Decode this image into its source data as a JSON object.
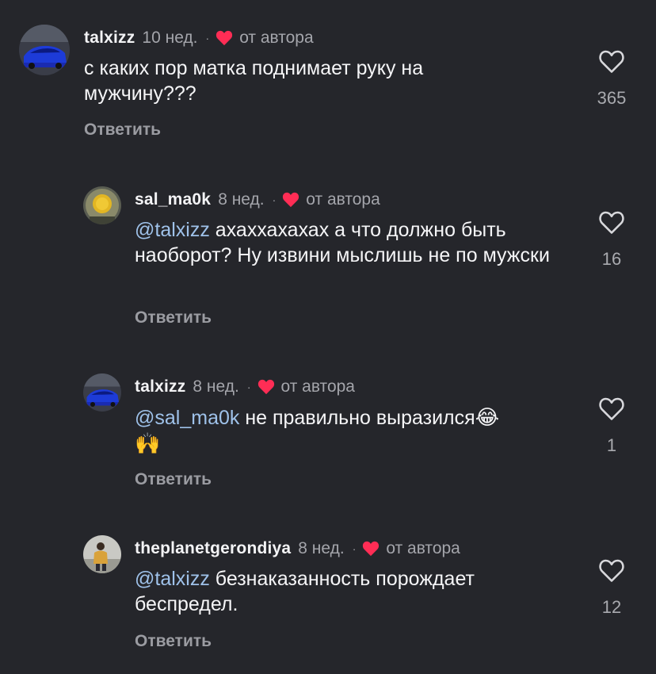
{
  "colors": {
    "background": "#25262b",
    "heart_accent": "#ff2d55",
    "mention": "#9fc2ea",
    "secondary_text": "#a4a5ab"
  },
  "comments": [
    {
      "username": "talxizz",
      "time": "10 нед.",
      "dot": "·",
      "author_label": "от автора",
      "text": "с каких пор матка поднимает руку на мужчину???",
      "mention": "",
      "reply_label": "Ответить",
      "likes": "365",
      "avatar_icon": "blue-car-avatar"
    },
    {
      "username": "sal_ma0k",
      "time": "8 нед.",
      "dot": "·",
      "author_label": "от автора",
      "mention": "@talxizz",
      "text": "ахаххахахах а что должно быть наоборот? Ну извини мыслишь не по мужски",
      "reply_label": "Ответить",
      "likes": "16",
      "avatar_icon": "yellow-face-avatar"
    },
    {
      "username": "talxizz",
      "time": "8 нед.",
      "dot": "·",
      "author_label": "от автора",
      "mention": "@sal_ma0k",
      "text": "не правильно выразился",
      "emoji_laugh": "😂",
      "emoji_hands": "🙌",
      "reply_label": "Ответить",
      "likes": "1",
      "avatar_icon": "blue-car-avatar"
    },
    {
      "username": "theplanetgerondiya",
      "time": "8 нед.",
      "dot": "·",
      "author_label": "от автора",
      "mention": "@talxizz",
      "text": "безнаказанность порождает беспредел.",
      "reply_label": "Ответить",
      "likes": "12",
      "avatar_icon": "person-photo-avatar"
    }
  ]
}
